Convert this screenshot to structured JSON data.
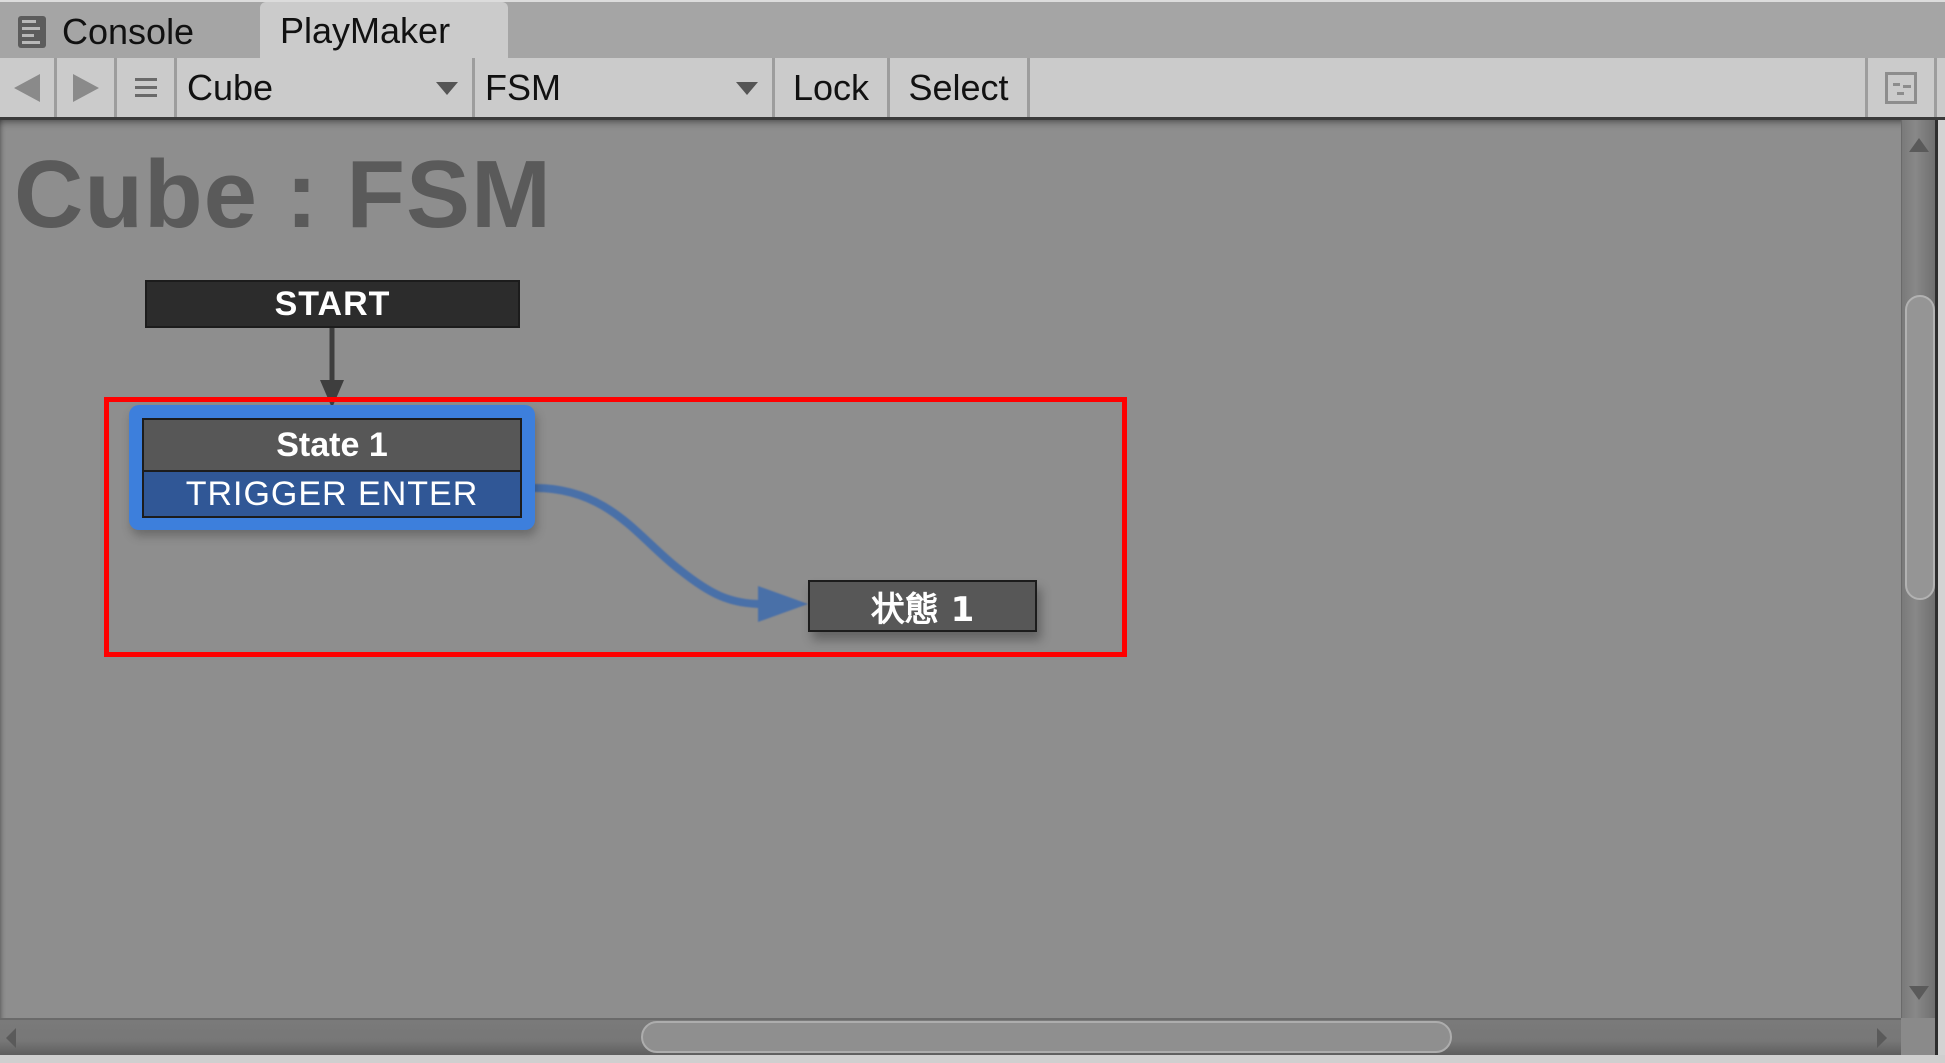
{
  "tabs": [
    {
      "label": "Console",
      "icon": "console-icon",
      "active": false
    },
    {
      "label": "PlayMaker",
      "active": true
    }
  ],
  "toolbar": {
    "prev_icon": "back-arrow-icon",
    "next_icon": "forward-arrow-icon",
    "menu_icon": "hamburger-menu-icon",
    "gameobject_select": {
      "value": "Cube"
    },
    "fsm_select": {
      "value": "FSM"
    },
    "lock_label": "Lock",
    "select_label": "Select",
    "minimap_icon": "minimap-toggle-icon"
  },
  "graph": {
    "title": "Cube : FSM",
    "start_label": "START",
    "states": [
      {
        "name": "State 1",
        "events": [
          "TRIGGER ENTER"
        ],
        "selected": true
      },
      {
        "name": "状態 1",
        "events": []
      }
    ],
    "transitions": [
      {
        "from": "START",
        "to": "State 1"
      },
      {
        "from": "State 1",
        "event": "TRIGGER ENTER",
        "to": "状態 1"
      }
    ],
    "colors": {
      "selection": "#3d7fdc",
      "event_bar": "#305796",
      "transition": "#4a6fa8",
      "highlight": "#ff0000",
      "canvas": "#8e8e8e"
    }
  }
}
